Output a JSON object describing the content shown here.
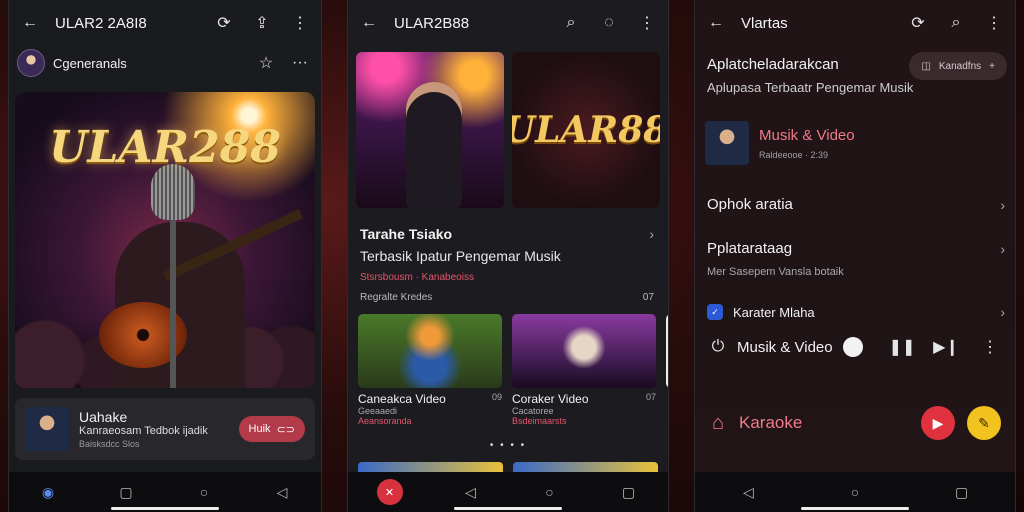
{
  "colors": {
    "accent": "#b33a48",
    "brand_gold": "#f6d77e",
    "link_pink": "#f07a8a"
  },
  "phone1": {
    "title": "ULAR2 2A8I8",
    "icons": {
      "back": "arrow-left-icon",
      "search": "search-refresh-icon",
      "share": "share-icon",
      "more": "more-vertical-icon"
    },
    "user": {
      "name": "Cgeneranals",
      "star": "☆",
      "menu": "···"
    },
    "hero_brand": "ULAR288",
    "player": {
      "title": "Uahake",
      "subtitle": "Kanraeosam Tedbok ijadik",
      "meta": "Baisksdcc Slos",
      "button_label": "Huik"
    }
  },
  "phone2": {
    "title": "ULAR2B88",
    "tile_brand": "ULAR88",
    "section_title": "Tarahe Tsiako",
    "section_sub": "Terbasik Ipatur Pengemar Musik",
    "section_tags": "Stsrsbousm · Kanabeoiss",
    "section_label": "Regralte Kredes",
    "section_count": "07",
    "cards": [
      {
        "title": "Caneakca Video",
        "meta": "Geeaaedi",
        "tag": "Aeansoranda",
        "count": "09"
      },
      {
        "title": "Coraker Video",
        "meta": "Cacatoree",
        "tag": "Bsdeimaarsts",
        "count": "07"
      }
    ],
    "pager": "• • • •",
    "heart_count": "07"
  },
  "phone3": {
    "title": "Vlartas",
    "app_name": "Aplatcheladarakcan",
    "app_desc": "Aplupasa Terbaatr Pengemar Musik",
    "chip_label": "Kanadfns",
    "chip_plus": "+",
    "media_title": "Musik & Video",
    "media_meta": "Raldeeooe · 2:39",
    "rows": [
      {
        "label": "Ophok aratia"
      },
      {
        "label": "Pplatarataag"
      }
    ],
    "subtle_line": "Mer Sasepem Vansla botaik",
    "feature_label": "Karater Mlaha",
    "player_label": "Musik & Video",
    "karaoke_label": "Karaoke"
  }
}
